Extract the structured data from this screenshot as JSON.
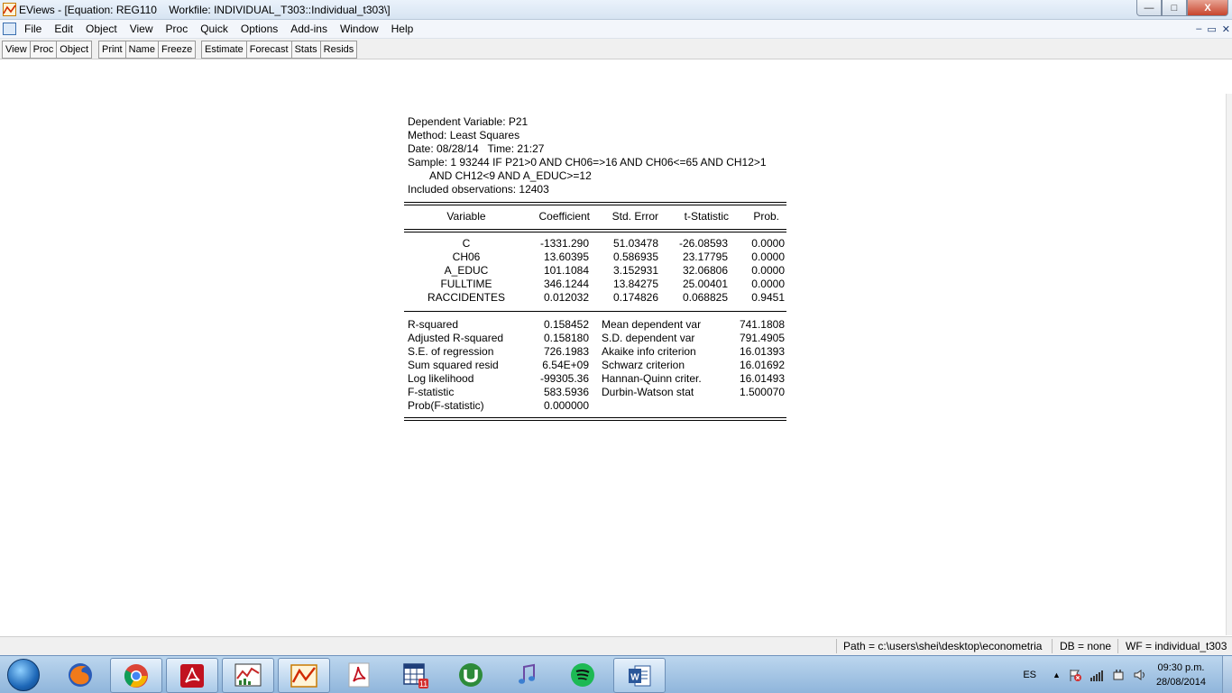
{
  "window": {
    "title": "EViews - [Equation: REG110    Workfile: INDIVIDUAL_T303::Individual_t303\\]",
    "controls": {
      "minimize": "—",
      "maximize": "□",
      "close": "X"
    }
  },
  "menubar": {
    "items": [
      "File",
      "Edit",
      "Object",
      "View",
      "Proc",
      "Quick",
      "Options",
      "Add-ins",
      "Window",
      "Help"
    ],
    "mdi": {
      "minimize": "–",
      "restore": "▭",
      "close": "✕"
    }
  },
  "toolbar": {
    "group1": [
      "View",
      "Proc",
      "Object"
    ],
    "group2": [
      "Print",
      "Name",
      "Freeze"
    ],
    "group3": [
      "Estimate",
      "Forecast",
      "Stats",
      "Resids"
    ]
  },
  "output": {
    "header": [
      "Dependent Variable: P21",
      "Method: Least Squares",
      "Date: 08/28/14   Time: 21:27",
      "Sample: 1 93244 IF P21>0 AND CH06=>16 AND CH06<=65 AND CH12>1",
      "AND CH12<9 AND A_EDUC>=12",
      "Included observations: 12403"
    ],
    "columns": [
      "Variable",
      "Coefficient",
      "Std. Error",
      "t-Statistic",
      "Prob."
    ],
    "rows": [
      [
        "C",
        "-1331.290",
        "51.03478",
        "-26.08593",
        "0.0000"
      ],
      [
        "CH06",
        "13.60395",
        "0.586935",
        "23.17795",
        "0.0000"
      ],
      [
        "A_EDUC",
        "101.1084",
        "3.152931",
        "32.06806",
        "0.0000"
      ],
      [
        "FULLTIME",
        "346.1244",
        "13.84275",
        "25.00401",
        "0.0000"
      ],
      [
        "RACCIDENTES",
        "0.012032",
        "0.174826",
        "0.068825",
        "0.9451"
      ]
    ],
    "stats": [
      [
        "R-squared",
        "0.158452",
        "Mean dependent var",
        "741.1808"
      ],
      [
        "Adjusted R-squared",
        "0.158180",
        "S.D. dependent var",
        "791.4905"
      ],
      [
        "S.E. of regression",
        "726.1983",
        "Akaike info criterion",
        "16.01393"
      ],
      [
        "Sum squared resid",
        "6.54E+09",
        "Schwarz criterion",
        "16.01692"
      ],
      [
        "Log likelihood",
        "-99305.36",
        "Hannan-Quinn criter.",
        "16.01493"
      ],
      [
        "F-statistic",
        "583.5936",
        "Durbin-Watson stat",
        "1.500070"
      ],
      [
        "Prob(F-statistic)",
        "0.000000",
        "",
        ""
      ]
    ]
  },
  "statusbar": {
    "path": "Path = c:\\users\\shei\\desktop\\econometria",
    "db": "DB = none",
    "wf": "WF = individual_t303"
  },
  "taskbar": {
    "apps": [
      "firefox-icon",
      "chrome-icon",
      "acrobat-icon",
      "eviews-chart-icon",
      "eviews-icon",
      "pdf-icon",
      "calendar-icon",
      "utorrent-icon",
      "itunes-icon",
      "spotify-icon",
      "word-icon"
    ],
    "tray_lang": "ES",
    "tray_up": "▲",
    "clock_time": "09:30 p.m.",
    "clock_date": "28/08/2014"
  }
}
